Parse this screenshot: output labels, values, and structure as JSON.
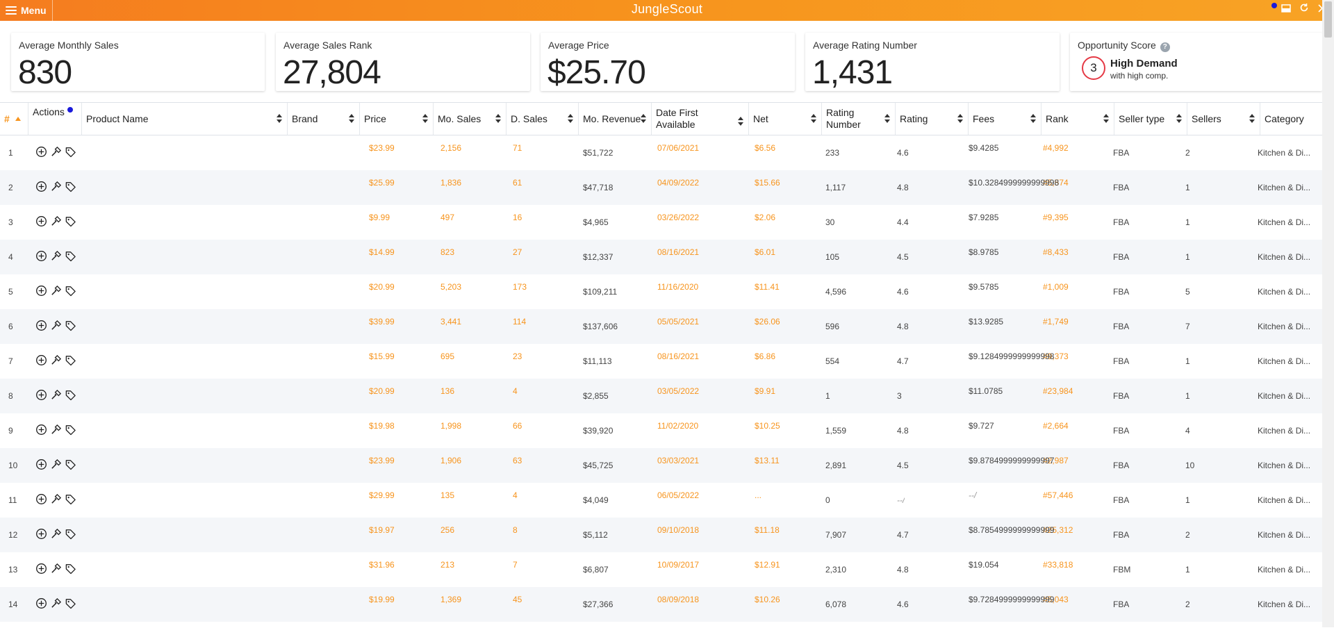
{
  "topbar": {
    "menu_label": "Menu",
    "title": "JungleScout"
  },
  "cards": {
    "avg_monthly_sales": {
      "label": "Average Monthly Sales",
      "value": "830"
    },
    "avg_sales_rank": {
      "label": "Average Sales Rank",
      "value": "27,804"
    },
    "avg_price": {
      "label": "Average Price",
      "value": "$25.70"
    },
    "avg_rating_number": {
      "label": "Average Rating Number",
      "value": "1,431"
    },
    "opportunity": {
      "label": "Opportunity Score",
      "score": "3",
      "demand": "High Demand",
      "competition": "with high comp."
    }
  },
  "columns": {
    "num": "#",
    "actions": "Actions",
    "product_name": "Product Name",
    "brand": "Brand",
    "price": "Price",
    "mo_sales": "Mo. Sales",
    "d_sales": "D. Sales",
    "mo_revenue": "Mo. Revenue",
    "date_first": "Date First Available",
    "net": "Net",
    "rating_number": "Rating Number",
    "rating": "Rating",
    "fees": "Fees",
    "rank": "Rank",
    "seller_type": "Seller type",
    "sellers": "Sellers",
    "category": "Category"
  },
  "rows": [
    {
      "n": "1",
      "price": "$23.99",
      "mo_sales": "2,156",
      "d_sales": "71",
      "revenue": "$51,722",
      "date": "07/06/2021",
      "net": "$6.56",
      "rating_number": "233",
      "rating": "4.6",
      "fees": "$9.4285",
      "rank": "#4,992",
      "seller_type": "FBA",
      "sellers": "2",
      "category": "Kitchen & Di..."
    },
    {
      "n": "2",
      "price": "$25.99",
      "mo_sales": "1,836",
      "d_sales": "61",
      "revenue": "$47,718",
      "date": "04/09/2022",
      "net": "$15.66",
      "rating_number": "1,117",
      "rating": "4.8",
      "fees": "$10.3284999999999998",
      "rank": "#5,574",
      "seller_type": "FBA",
      "sellers": "1",
      "category": "Kitchen & Di..."
    },
    {
      "n": "3",
      "price": "$9.99",
      "mo_sales": "497",
      "d_sales": "16",
      "revenue": "$4,965",
      "date": "03/26/2022",
      "net": "$2.06",
      "rating_number": "30",
      "rating": "4.4",
      "fees": "$7.9285",
      "rank": "#9,395",
      "seller_type": "FBA",
      "sellers": "1",
      "category": "Kitchen & Di..."
    },
    {
      "n": "4",
      "price": "$14.99",
      "mo_sales": "823",
      "d_sales": "27",
      "revenue": "$12,337",
      "date": "08/16/2021",
      "net": "$6.01",
      "rating_number": "105",
      "rating": "4.5",
      "fees": "$8.9785",
      "rank": "#8,433",
      "seller_type": "FBA",
      "sellers": "1",
      "category": "Kitchen & Di..."
    },
    {
      "n": "5",
      "price": "$20.99",
      "mo_sales": "5,203",
      "d_sales": "173",
      "revenue": "$109,211",
      "date": "11/16/2020",
      "net": "$11.41",
      "rating_number": "4,596",
      "rating": "4.6",
      "fees": "$9.5785",
      "rank": "#1,009",
      "seller_type": "FBA",
      "sellers": "5",
      "category": "Kitchen & Di..."
    },
    {
      "n": "6",
      "price": "$39.99",
      "mo_sales": "3,441",
      "d_sales": "114",
      "revenue": "$137,606",
      "date": "05/05/2021",
      "net": "$26.06",
      "rating_number": "596",
      "rating": "4.8",
      "fees": "$13.9285",
      "rank": "#1,749",
      "seller_type": "FBA",
      "sellers": "7",
      "category": "Kitchen & Di..."
    },
    {
      "n": "7",
      "price": "$15.99",
      "mo_sales": "695",
      "d_sales": "23",
      "revenue": "$11,113",
      "date": "08/16/2021",
      "net": "$6.86",
      "rating_number": "554",
      "rating": "4.7",
      "fees": "$9.1284999999999998",
      "rank": "#9,373",
      "seller_type": "FBA",
      "sellers": "1",
      "category": "Kitchen & Di..."
    },
    {
      "n": "8",
      "price": "$20.99",
      "mo_sales": "136",
      "d_sales": "4",
      "revenue": "$2,855",
      "date": "03/05/2022",
      "net": "$9.91",
      "rating_number": "1",
      "rating": "3",
      "fees": "$11.0785",
      "rank": "#23,984",
      "seller_type": "FBA",
      "sellers": "1",
      "category": "Kitchen & Di..."
    },
    {
      "n": "9",
      "price": "$19.98",
      "mo_sales": "1,998",
      "d_sales": "66",
      "revenue": "$39,920",
      "date": "11/02/2020",
      "net": "$10.25",
      "rating_number": "1,559",
      "rating": "4.8",
      "fees": "$9.727",
      "rank": "#2,664",
      "seller_type": "FBA",
      "sellers": "4",
      "category": "Kitchen & Di..."
    },
    {
      "n": "10",
      "price": "$23.99",
      "mo_sales": "1,906",
      "d_sales": "63",
      "revenue": "$45,725",
      "date": "03/03/2021",
      "net": "$13.11",
      "rating_number": "2,891",
      "rating": "4.5",
      "fees": "$9.8784999999999997",
      "rank": "#2,987",
      "seller_type": "FBA",
      "sellers": "10",
      "category": "Kitchen & Di..."
    },
    {
      "n": "11",
      "price": "$29.99",
      "mo_sales": "135",
      "d_sales": "4",
      "revenue": "$4,049",
      "date": "06/05/2022",
      "net": "...",
      "rating_number": "0",
      "rating": "--/",
      "fees": "--/",
      "rank": "#57,446",
      "seller_type": "FBA",
      "sellers": "1",
      "category": "Kitchen & Di..."
    },
    {
      "n": "12",
      "price": "$19.97",
      "mo_sales": "256",
      "d_sales": "8",
      "revenue": "$5,112",
      "date": "09/10/2018",
      "net": "$11.18",
      "rating_number": "7,907",
      "rating": "4.7",
      "fees": "$8.7854999999999999",
      "rank": "#25,312",
      "seller_type": "FBA",
      "sellers": "2",
      "category": "Kitchen & Di..."
    },
    {
      "n": "13",
      "price": "$31.96",
      "mo_sales": "213",
      "d_sales": "7",
      "revenue": "$6,807",
      "date": "10/09/2017",
      "net": "$12.91",
      "rating_number": "2,310",
      "rating": "4.8",
      "fees": "$19.054",
      "rank": "#33,818",
      "seller_type": "FBM",
      "sellers": "1",
      "category": "Kitchen & Di..."
    },
    {
      "n": "14",
      "price": "$19.99",
      "mo_sales": "1,369",
      "d_sales": "45",
      "revenue": "$27,366",
      "date": "08/09/2018",
      "net": "$10.26",
      "rating_number": "6,078",
      "rating": "4.6",
      "fees": "$9.7284999999999999",
      "rank": "#5,043",
      "seller_type": "FBA",
      "sellers": "2",
      "category": "Kitchen & Di..."
    }
  ],
  "colors": {
    "brand_orange": "#f7941d",
    "score_ring": "#e53945",
    "notification": "#1a1adb"
  }
}
